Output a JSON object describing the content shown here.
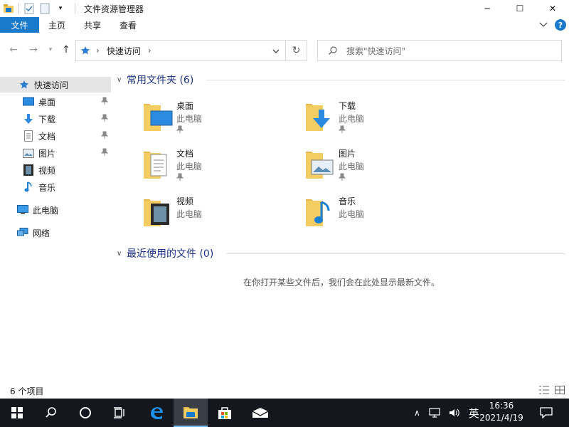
{
  "window": {
    "title": "文件资源管理器",
    "controls": {
      "minimize": "─",
      "maximize": "☐",
      "close": "✕"
    }
  },
  "ribbon": {
    "tabs": [
      "文件",
      "主页",
      "共享",
      "查看"
    ],
    "expand_icon": "chevron-down",
    "help_label": "?"
  },
  "address": {
    "path": [
      "快速访问"
    ],
    "search_placeholder": "搜索\"快速访问\""
  },
  "nav": {
    "quick_access": "快速访问",
    "pinned": [
      "桌面",
      "下载",
      "文档",
      "图片"
    ],
    "other": [
      "视频",
      "音乐"
    ],
    "this_pc": "此电脑",
    "network": "网络"
  },
  "content": {
    "frequent_header": "常用文件夹 (6)",
    "recent_header": "最近使用的文件 (0)",
    "empty_message": "在你打开某些文件后，我们会在此处显示最新文件。",
    "folders": [
      {
        "name": "桌面",
        "location": "此电脑",
        "pinned": true
      },
      {
        "name": "下载",
        "location": "此电脑",
        "pinned": true
      },
      {
        "name": "文档",
        "location": "此电脑",
        "pinned": true
      },
      {
        "name": "图片",
        "location": "此电脑",
        "pinned": true
      },
      {
        "name": "视频",
        "location": "此电脑",
        "pinned": false
      },
      {
        "name": "音乐",
        "location": "此电脑",
        "pinned": false
      }
    ]
  },
  "status": {
    "item_count": "6 个项目"
  },
  "taskbar": {
    "ime": "英",
    "time": "16:36",
    "date": "2021/4/19"
  },
  "colors": {
    "accent": "#1979ca",
    "header_text": "#1e3287",
    "taskbar_bg": "#14181e",
    "folder": "#f3cd62"
  }
}
